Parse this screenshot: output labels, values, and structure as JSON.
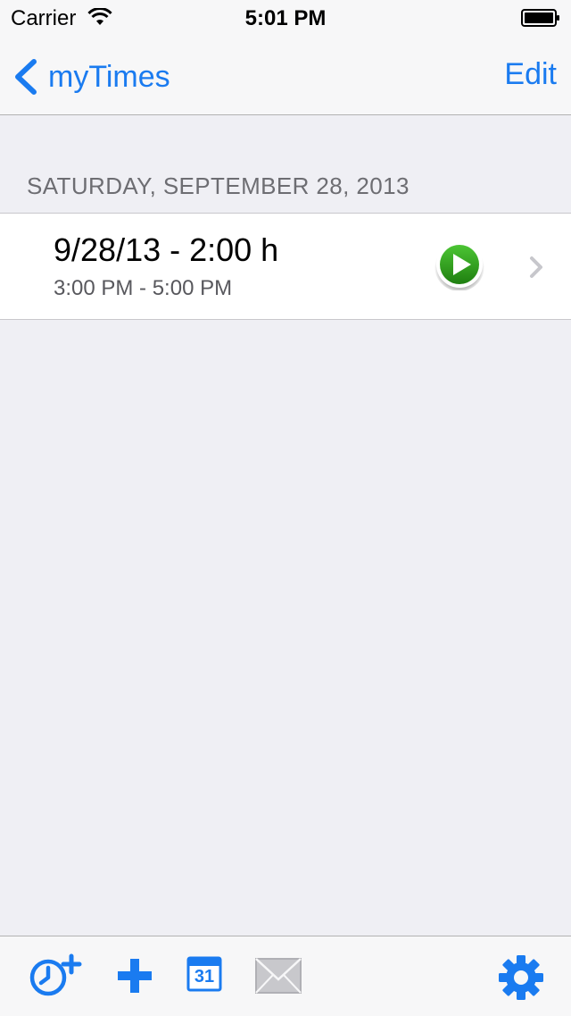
{
  "status_bar": {
    "carrier": "Carrier",
    "time": "5:01 PM"
  },
  "nav": {
    "back_label": "myTimes",
    "edit_label": "Edit"
  },
  "section": {
    "header": "SATURDAY, SEPTEMBER 28, 2013"
  },
  "entries": [
    {
      "title": "9/28/13 - 2:00 h",
      "subtitle": "3:00 PM - 5:00 PM"
    }
  ],
  "toolbar": {
    "calendar_day": "31",
    "icons": [
      "add-timer-icon",
      "plus-icon",
      "calendar-icon",
      "mail-icon",
      "gear-icon"
    ]
  },
  "colors": {
    "accent": "#1a7bf0",
    "play_green": "#2e9b1a",
    "background": "#efeff4"
  }
}
